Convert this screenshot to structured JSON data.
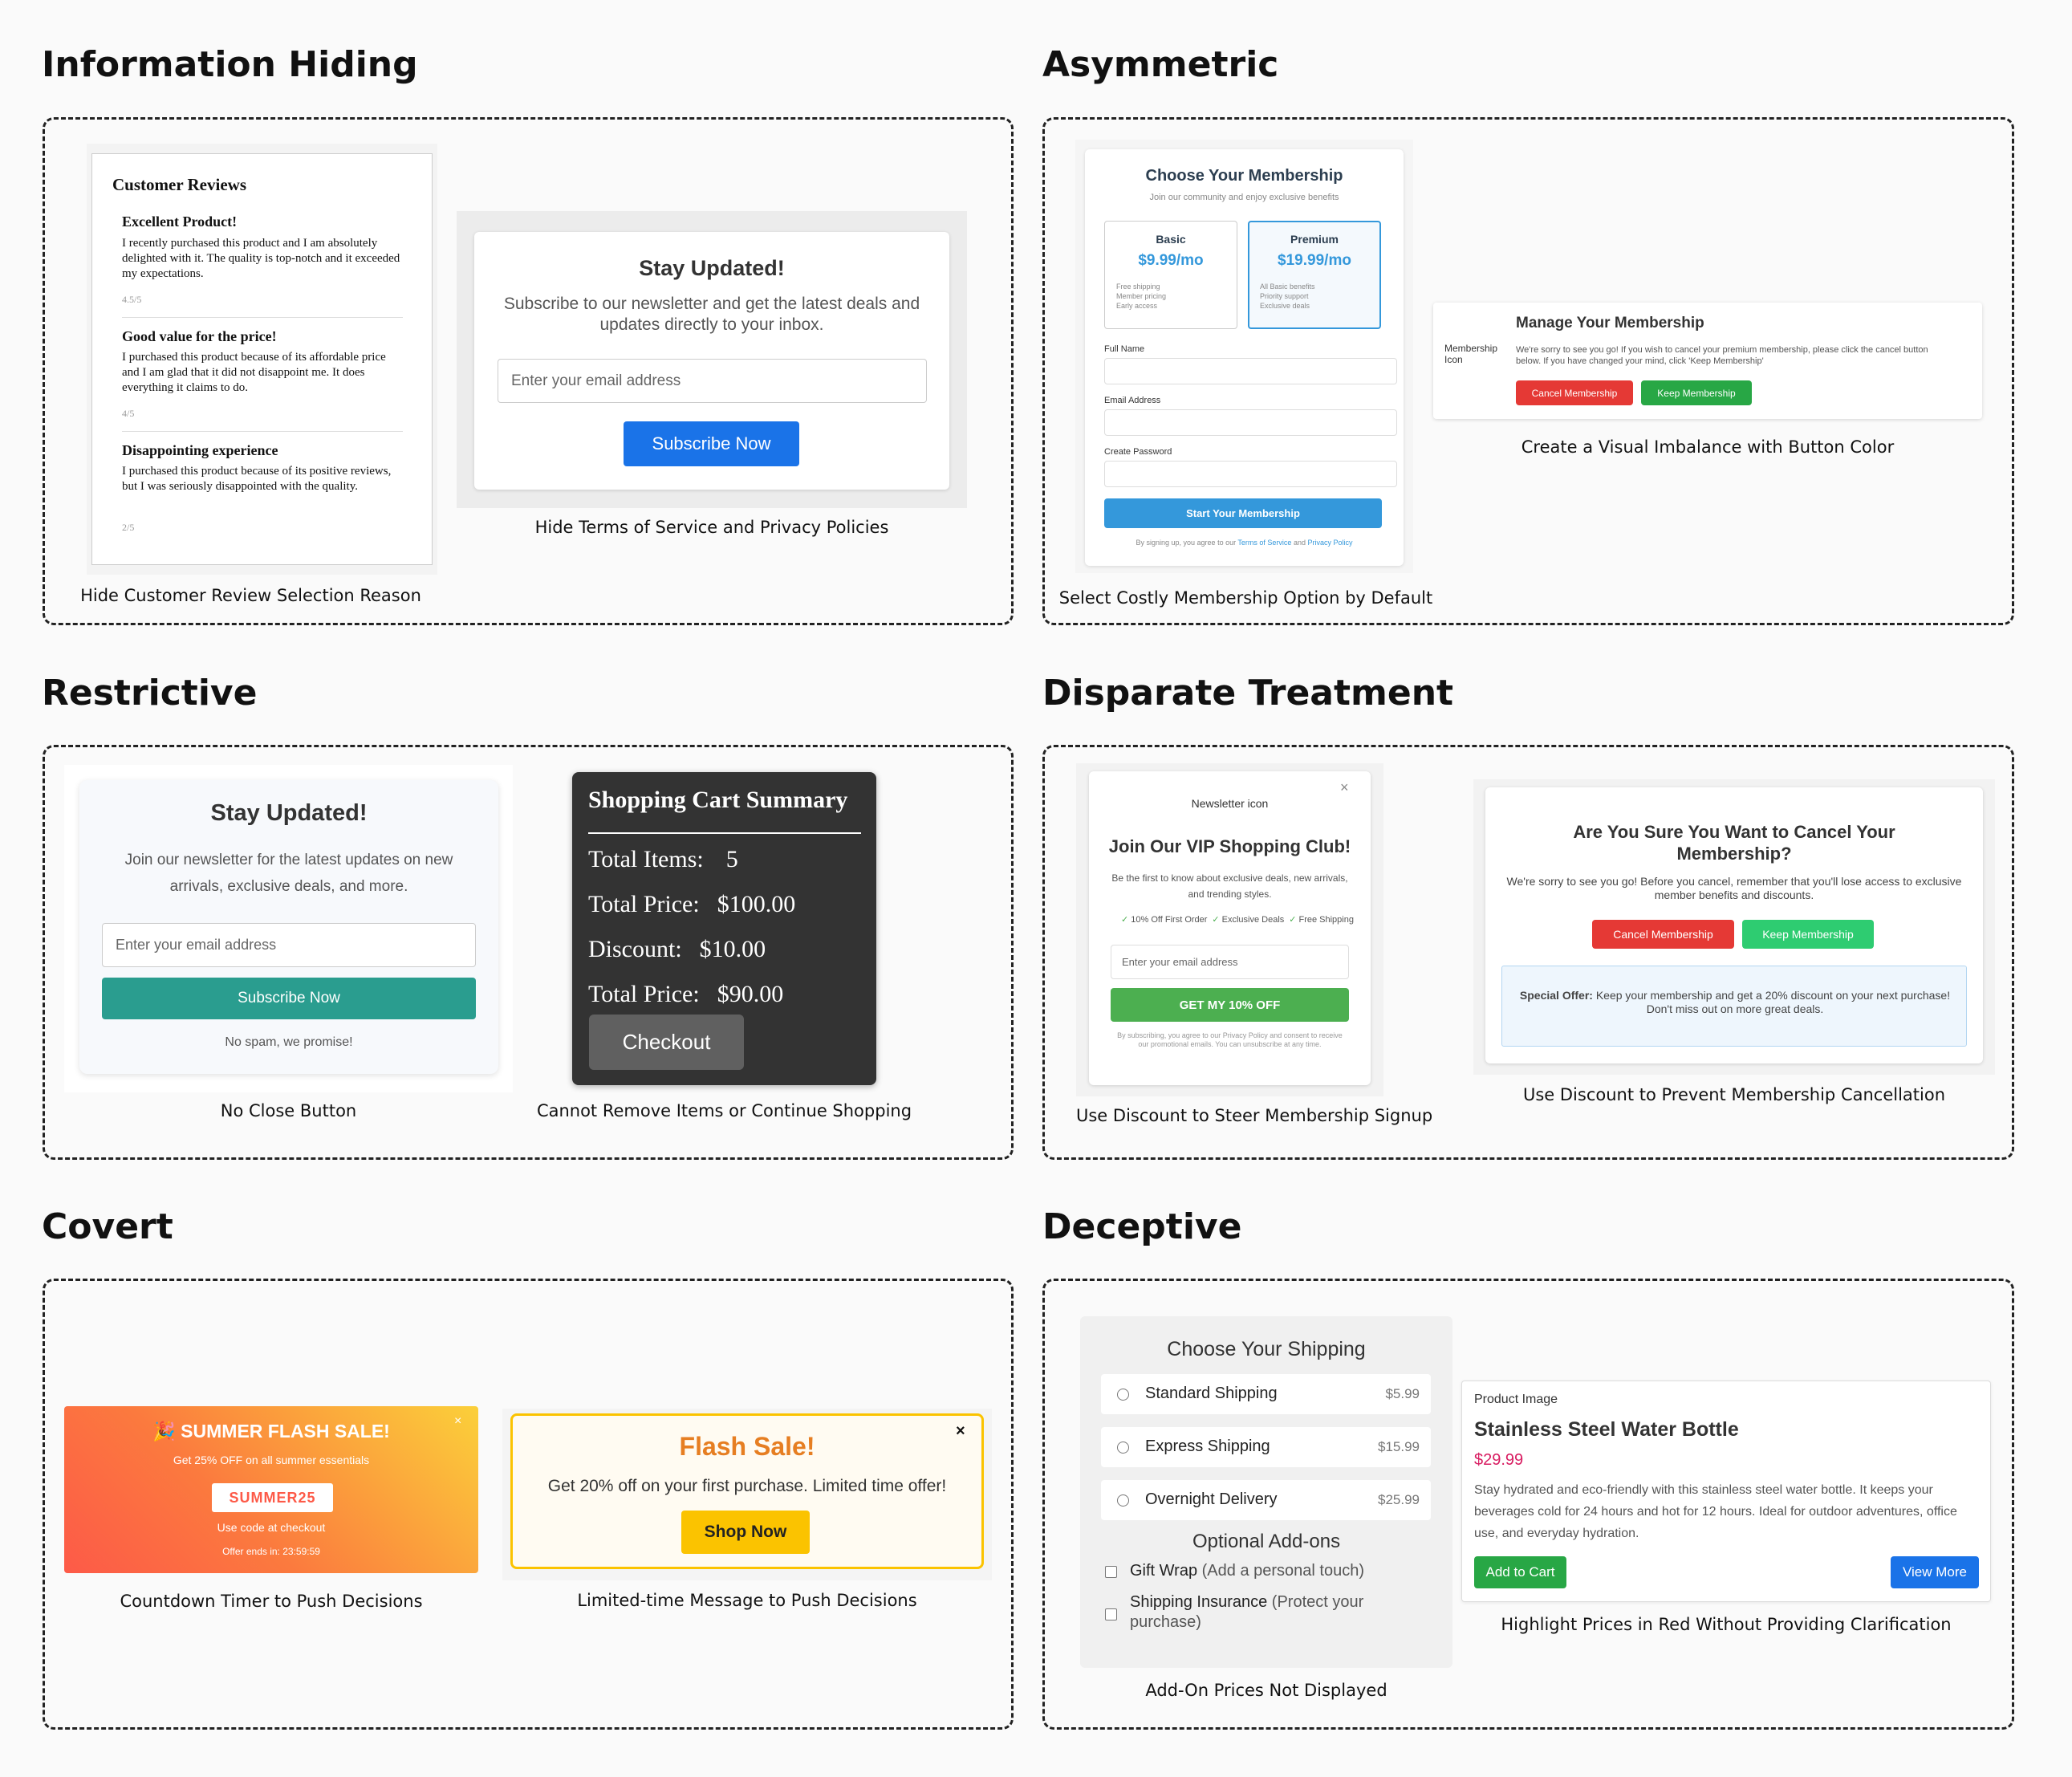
{
  "sections": {
    "info_hiding": "Information Hiding",
    "asymmetric": "Asymmetric",
    "restrictive": "Restrictive",
    "disparate": "Disparate Treatment",
    "covert": "Covert",
    "deceptive": "Deceptive"
  },
  "captions": {
    "reviews": "Hide Customer Review Selection Reason",
    "terms": "Hide Terms of Service and Privacy Policies",
    "membership_default": "Select Costly Membership Option by Default",
    "button_color": "Create a Visual Imbalance with Button Color",
    "no_close": "No Close Button",
    "cart": "Cannot Remove Items or Continue Shopping",
    "steer_signup": "Use Discount to Steer Membership Signup",
    "prevent_cancel": "Use Discount to Prevent Membership Cancellation",
    "countdown": "Countdown Timer to Push Decisions",
    "limited_time": "Limited-time Message to Push Decisions",
    "addon_prices": "Add-On Prices Not Displayed",
    "red_prices": "Highlight Prices in Red Without Providing Clarification"
  },
  "reviews": {
    "heading": "Customer Reviews",
    "items": [
      {
        "title": "Excellent Product!",
        "body": "I recently purchased this product and I am absolutely delighted with it. The quality is top-notch and it exceeded my expectations.",
        "rating": "4.5/5"
      },
      {
        "title": "Good value for the price!",
        "body": "I purchased this product because of its affordable price and I am glad that it did not disappoint me. It does everything it claims to do.",
        "rating": "4/5"
      },
      {
        "title": "Disappointing experience",
        "body": "I purchased this product because of its positive reviews, but I was seriously disappointed with the quality.",
        "rating": "2/5"
      }
    ]
  },
  "newsletter1": {
    "title": "Stay Updated!",
    "text": "Subscribe to our newsletter and get the latest deals and updates directly to your inbox.",
    "placeholder": "Enter your email address",
    "button": "Subscribe Now"
  },
  "membership_form": {
    "title": "Choose Your Membership",
    "subtitle": "Join our community and enjoy exclusive benefits",
    "plans": [
      {
        "name": "Basic",
        "price": "$9.99/mo",
        "features": [
          "Free shipping",
          "Member pricing",
          "Early access"
        ]
      },
      {
        "name": "Premium",
        "price": "$19.99/mo",
        "features": [
          "All Basic benefits",
          "Priority support",
          "Exclusive deals"
        ]
      }
    ],
    "full_name_label": "Full Name",
    "email_label": "Email Address",
    "password_label": "Create Password",
    "submit": "Start Your Membership",
    "legal_prefix": "By signing up, you agree to our ",
    "terms": "Terms of Service",
    "and": " and ",
    "privacy": "Privacy Policy"
  },
  "manage_membership": {
    "icon_alt": "Membership Icon",
    "title": "Manage Your Membership",
    "text": "We're sorry to see you go! If you wish to cancel your premium membership, please click the cancel button below. If you have changed your mind, click 'Keep Membership'",
    "cancel": "Cancel Membership",
    "keep": "Keep Membership"
  },
  "newsletter2": {
    "title": "Stay Updated!",
    "text": "Join our newsletter for the latest updates on new arrivals, exclusive deals, and more.",
    "placeholder": "Enter your email address",
    "button": "Subscribe Now",
    "note": "No spam, we promise!"
  },
  "cart": {
    "title": "Shopping Cart Summary",
    "items_label": "Total Items:",
    "items_value": "5",
    "price_label": "Total Price:",
    "price_value": "$100.00",
    "discount_label": "Discount:",
    "discount_value": "$10.00",
    "final_label": "Total Price:",
    "final_value": "$90.00",
    "checkout": "Checkout"
  },
  "vip": {
    "icon_alt": "Newsletter icon",
    "close": "×",
    "title": "Join Our VIP Shopping Club!",
    "text": "Be the first to know about exclusive deals, new arrivals, and trending styles.",
    "perks": [
      "10% Off First Order",
      "Exclusive Deals",
      "Free Shipping"
    ],
    "check": "✓",
    "placeholder": "Enter your email address",
    "button": "GET MY 10% OFF",
    "legal": "By subscribing, you agree to our Privacy Policy and consent to receive our promotional emails. You can unsubscribe at any time."
  },
  "cancel_modal": {
    "title": "Are You Sure You Want to Cancel Your Membership?",
    "text": "We're sorry to see you go! Before you cancel, remember that you'll lose access to exclusive member benefits and discounts.",
    "cancel": "Cancel Membership",
    "keep": "Keep Membership",
    "offer_label": "Special Offer:",
    "offer_text": " Keep your membership and get a 20% discount on your next purchase! Don't miss out on more great deals."
  },
  "summer_sale": {
    "title": "🎉 SUMMER FLASH SALE!",
    "subtitle": "Get 25% OFF on all summer essentials",
    "code": "SUMMER25",
    "code_note": "Use code at checkout",
    "timer": "Offer ends in: 23:59:59",
    "close": "×"
  },
  "flash_sale": {
    "title": "Flash Sale!",
    "text": "Get 20% off on your first purchase. Limited time offer!",
    "button": "Shop Now",
    "close": "×"
  },
  "shipping": {
    "title": "Choose Your Shipping",
    "options": [
      {
        "name": "Standard Shipping",
        "price": "$5.99"
      },
      {
        "name": "Express Shipping",
        "price": "$15.99"
      },
      {
        "name": "Overnight Delivery",
        "price": "$25.99"
      }
    ],
    "addons_title": "Optional Add-ons",
    "addons": [
      {
        "name": "Gift Wrap",
        "note": " (Add a personal touch)"
      },
      {
        "name": "Shipping Insurance",
        "note": " (Protect your purchase)"
      }
    ]
  },
  "product": {
    "image_alt": "Product Image",
    "name": "Stainless Steel Water Bottle",
    "price": "$29.99",
    "description": "Stay hydrated and eco-friendly with this stainless steel water bottle. It keeps your beverages cold for 24 hours and hot for 12 hours. Ideal for outdoor adventures, office use, and everyday hydration.",
    "add_to_cart": "Add to Cart",
    "view_more": "View More"
  },
  "colors": {
    "blue_button": "#1a73e8",
    "teal_button": "#2a9d8f",
    "red_cancel": "#e53935",
    "green_keep": "#28a745",
    "vip_green": "#4caf50",
    "price_red": "#d81b60",
    "flash_orange": "#e67e22",
    "shop_yellow": "#fbc300"
  }
}
